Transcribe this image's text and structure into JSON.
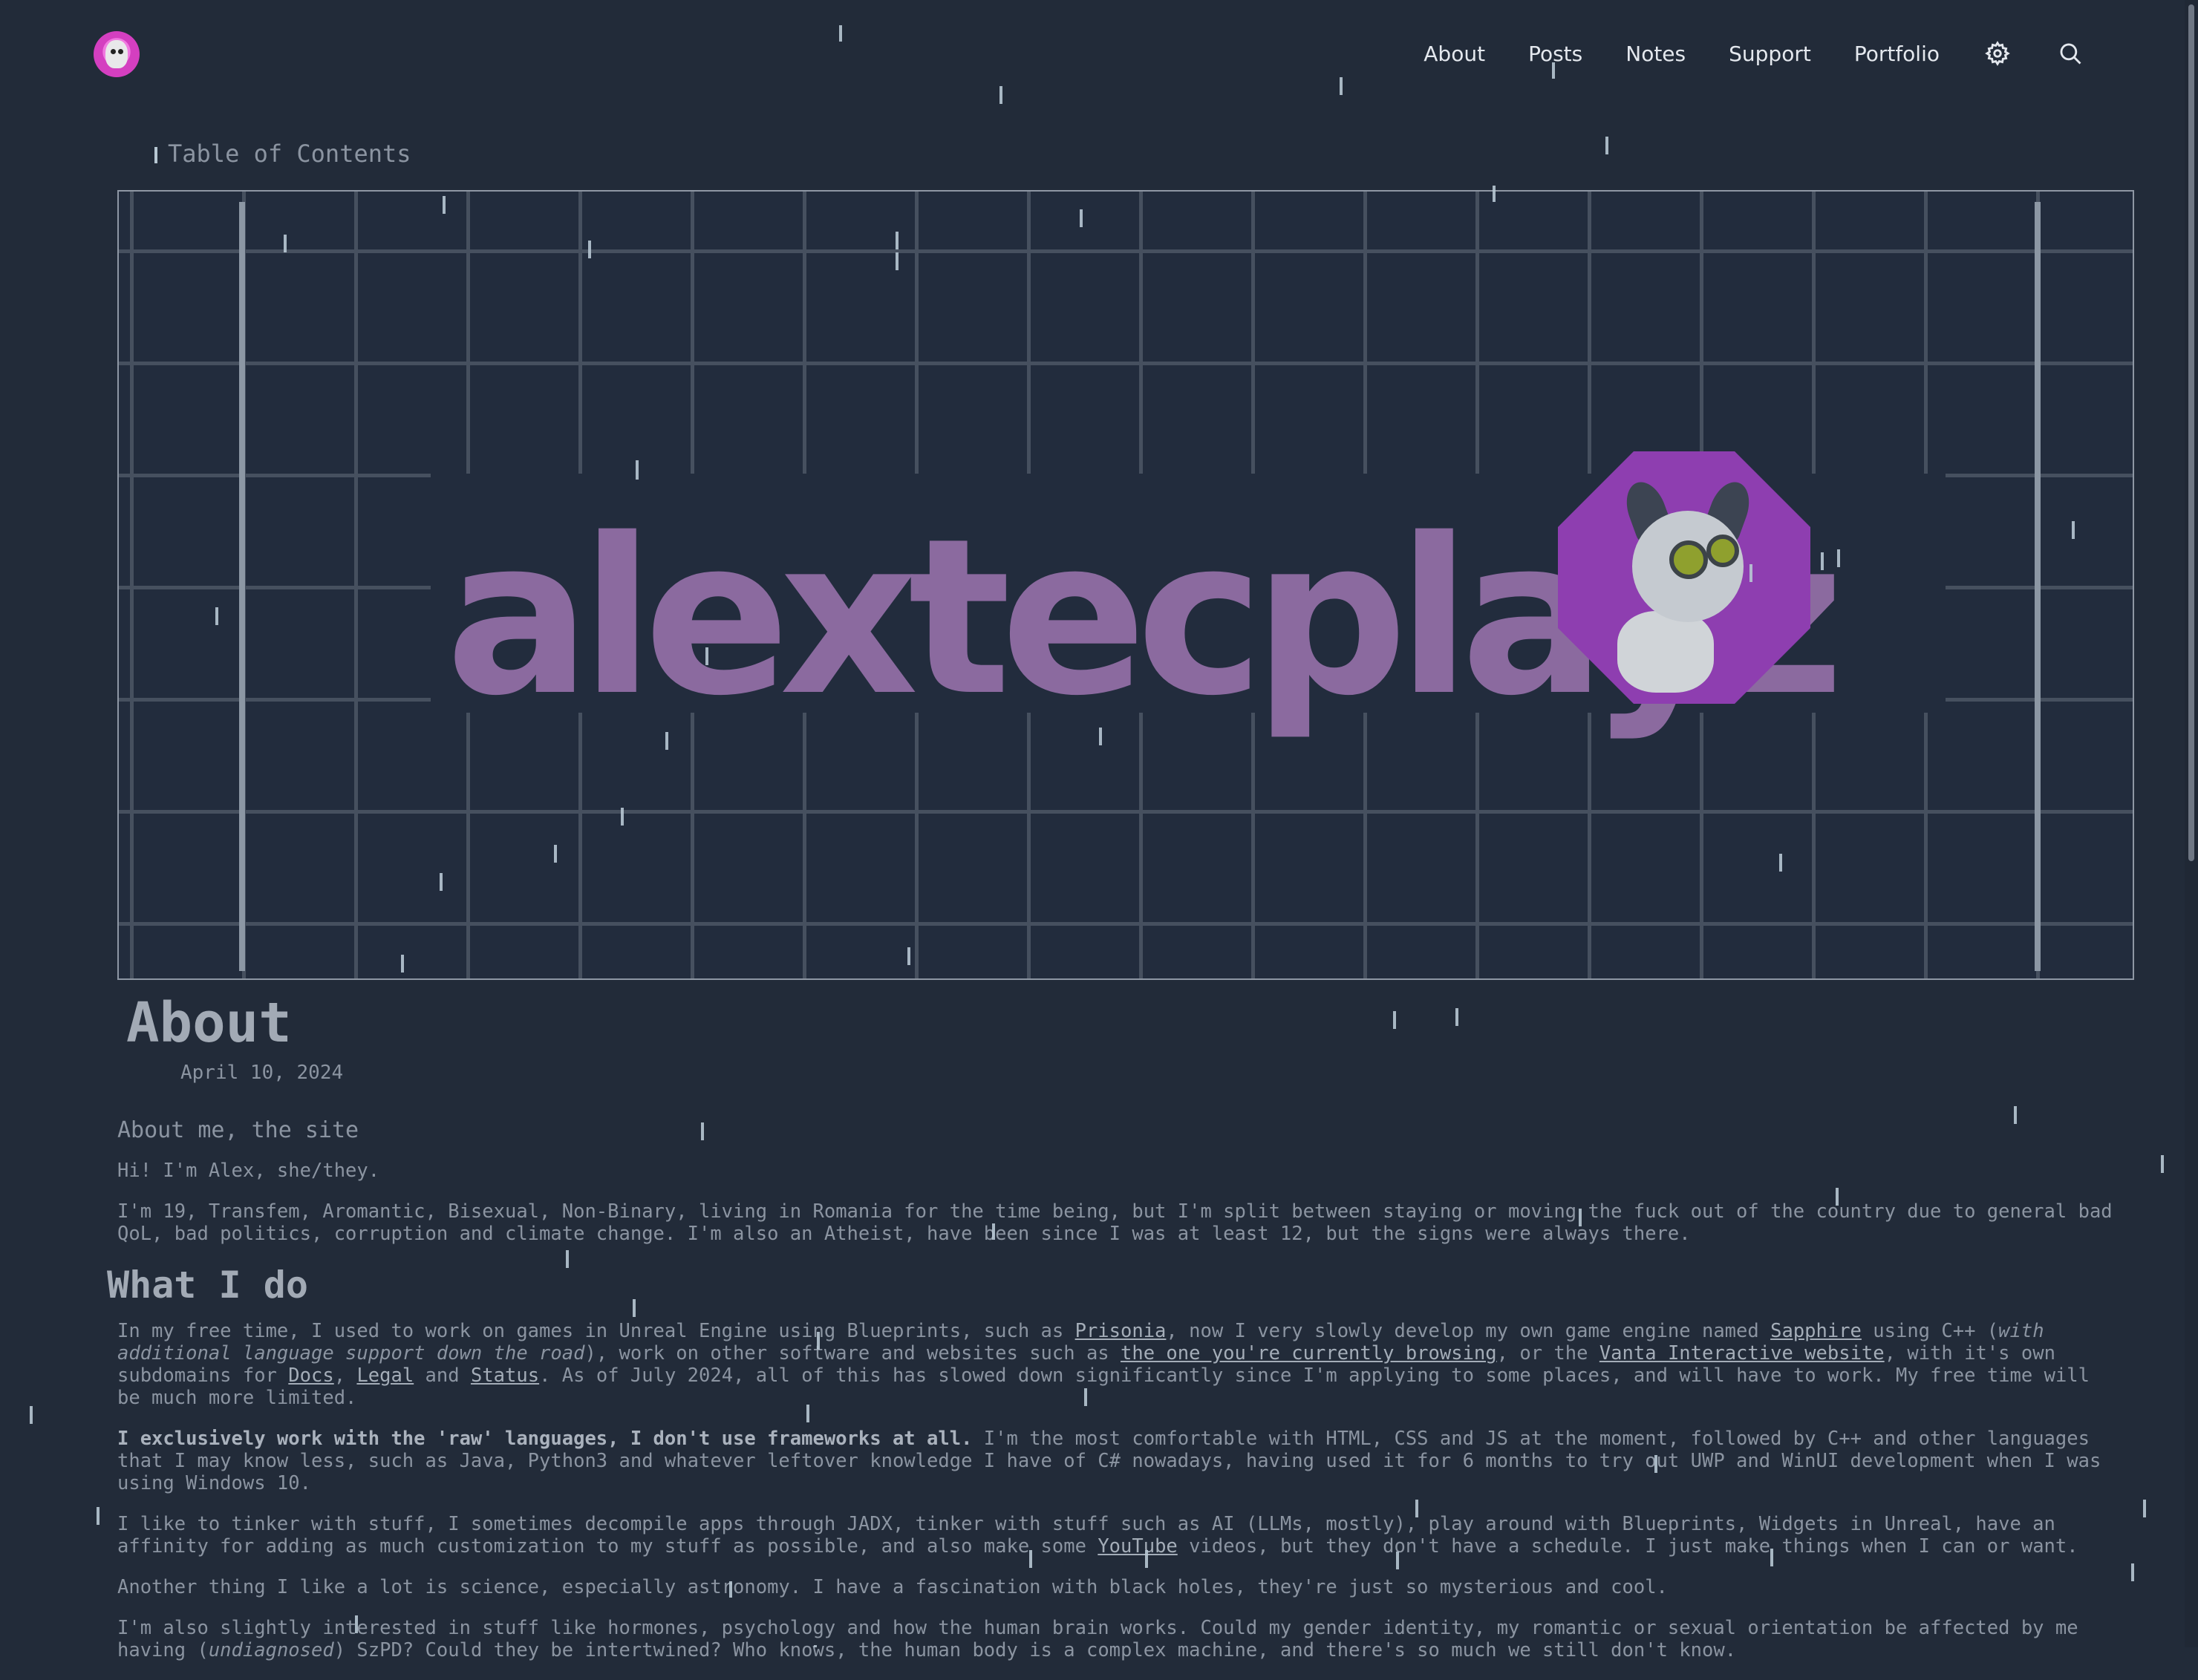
{
  "header": {
    "nav": [
      "About",
      "Posts",
      "Notes",
      "Support",
      "Portfolio"
    ],
    "icons": [
      "settings-icon",
      "search-icon"
    ]
  },
  "toc_label": "Table of Contents",
  "banner": {
    "brand": "alextecplayz"
  },
  "article": {
    "title": "About",
    "date": "April 10, 2024",
    "section_label": "About me, the site",
    "p1": "Hi! I'm Alex, she/they.",
    "p2": "I'm 19, Transfem, Aromantic, Bisexual, Non-Binary, living in Romania for the time being, but I'm split between staying or moving the fuck out of the country due to general bad QoL, bad politics, corruption and climate change. I'm also an Atheist, have been since I was at least 12, but the signs were always there.",
    "h2": "What I do",
    "p3": {
      "a": "In my free time, I used to work on games in Unreal Engine using Blueprints, such as ",
      "link_prisonia": "Prisonia",
      "b": ", now I very slowly develop my own game engine named ",
      "link_sapphire": "Sapphire",
      "c": " using C++ (",
      "em": "with additional language support down the road",
      "d": "), work on other software and websites such as ",
      "link_site": "the one you're currently browsing",
      "e": ", or the ",
      "link_vanta": "Vanta Interactive website",
      "f": ", with it's own subdomains for ",
      "link_docs": "Docs",
      "g": ", ",
      "link_legal": "Legal",
      "h": " and ",
      "link_status": "Status",
      "i": ". As of July 2024, all of this has slowed down significantly since I'm applying to some places, and will have to work. My free time will be much more limited."
    },
    "p4": {
      "strong": "I exclusively work with the 'raw' languages, I don't use frameworks at all.",
      "rest": " I'm the most comfortable with HTML, CSS and JS at the moment, followed by C++ and other languages that I may know less, such as Java, Python3 and whatever leftover knowledge I have of C# nowadays, having used it for 6 months to try out UWP and WinUI development when I was using Windows 10."
    },
    "p5": {
      "a": "I like to tinker with stuff, I sometimes decompile apps through JADX, tinker with stuff such as AI (LLMs, mostly), play around with Blueprints, Widgets in Unreal, have an affinity for adding as much customization to my stuff as possible, and also make some ",
      "link_youtube": "YouTube",
      "b": " videos, but they don't have a schedule. I just make things when I can or want."
    },
    "p6": "Another thing I like a lot is science, especially astronomy. I have a fascination with black holes, they're just so mysterious and cool.",
    "p7": {
      "a": "I'm also slightly interested in stuff like hormones, psychology and how the human brain works. Could my gender identity, my romantic or sexual orientation be affected by me having (",
      "em": "undiagnosed",
      "b": ") SzPD? Could they be intertwined? Who knows, the human body is a complex machine, and there's so much we still don't know."
    }
  },
  "colors": {
    "background": "#222b39",
    "text": "#8b94a1",
    "brand_purple": "#8e3eb0",
    "rain": "#b7c7d3"
  }
}
